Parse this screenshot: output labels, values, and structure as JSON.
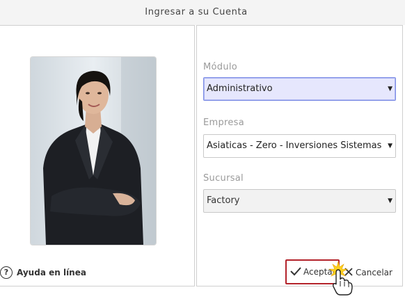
{
  "window": {
    "title": "Ingresar a su Cuenta"
  },
  "form": {
    "modulo": {
      "label": "Módulo",
      "value": "Administrativo"
    },
    "empresa": {
      "label": "Empresa",
      "value": "Asiaticas - Zero - Inversiones Sistemas"
    },
    "sucursal": {
      "label": "Sucursal",
      "value": "Factory"
    }
  },
  "footer": {
    "help_label": "Ayuda en línea",
    "accept_label": "Aceptar",
    "cancel_label": "Cancelar"
  },
  "icons": {
    "help": "question-circle-icon",
    "accept": "checkmark-icon",
    "cancel": "x-icon",
    "dropdown": "triangle-down-icon",
    "cursor": "hand-pointer-icon"
  },
  "colors": {
    "accent_focus": "#e6e7fd",
    "accept_border": "#b3232b"
  }
}
